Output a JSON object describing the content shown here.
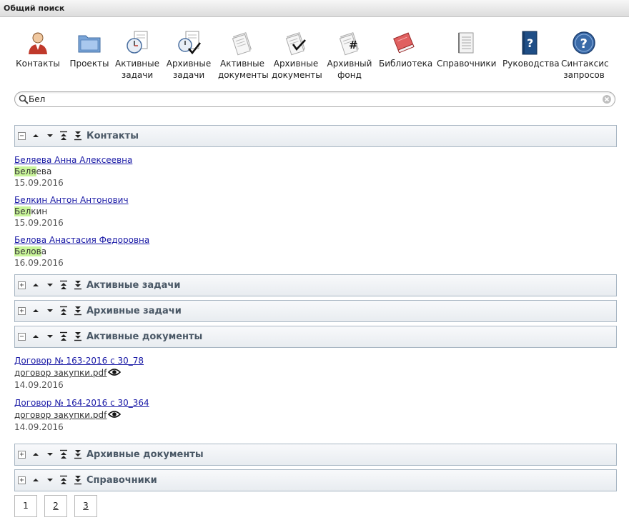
{
  "window": {
    "title": "Общий поиск"
  },
  "toolbar": {
    "items": [
      {
        "id": "contacts",
        "label_lines": [
          "Контакты"
        ]
      },
      {
        "id": "projects",
        "label_lines": [
          "Проекты"
        ]
      },
      {
        "id": "active-tasks",
        "label_lines": [
          "Активные",
          "задачи"
        ]
      },
      {
        "id": "archive-tasks",
        "label_lines": [
          "Архивные",
          "задачи"
        ]
      },
      {
        "id": "active-docs",
        "label_lines": [
          "Активные",
          "документы"
        ]
      },
      {
        "id": "archive-docs",
        "label_lines": [
          "Архивные",
          "документы"
        ]
      },
      {
        "id": "archive-fund",
        "label_lines": [
          "Архивный",
          "фонд"
        ]
      },
      {
        "id": "library",
        "label_lines": [
          "Библиотека"
        ]
      },
      {
        "id": "references",
        "label_lines": [
          "Справочники"
        ]
      },
      {
        "id": "manuals",
        "label_lines": [
          "Руководства"
        ]
      },
      {
        "id": "query-syntax",
        "label_lines": [
          "Синтаксис",
          "запросов"
        ]
      }
    ]
  },
  "search": {
    "value": "Бел",
    "icon": "search-icon",
    "clear_icon": "clear-icon"
  },
  "sections": {
    "contacts": {
      "title": "Контакты",
      "toggle": "−"
    },
    "active_tasks": {
      "title": "Активные задачи",
      "toggle": "+"
    },
    "archive_tasks": {
      "title": "Архивные задачи",
      "toggle": "+"
    },
    "active_docs": {
      "title": "Активные документы",
      "toggle": "−"
    },
    "archive_docs": {
      "title": "Архивные документы",
      "toggle": "+"
    },
    "references": {
      "title": "Справочники",
      "toggle": "+"
    }
  },
  "contacts": [
    {
      "name": "Беляева Анна Алексеевна",
      "match": "Беля",
      "rest": "ева",
      "date": "15.09.2016"
    },
    {
      "name": "Белкин Антон Антонович",
      "match": "Бел",
      "rest": "кин",
      "date": "15.09.2016"
    },
    {
      "name": "Белова Анастасия Федоровна",
      "match": "Белов",
      "rest": "а",
      "date": "16.09.2016"
    }
  ],
  "documents": [
    {
      "title": "Договор № 163-2016 с 30_78",
      "file": "договор закупки.pdf",
      "date": "14.09.2016"
    },
    {
      "title": "Договор № 164-2016 с 30_364",
      "file": "договор закупки.pdf",
      "date": "14.09.2016"
    }
  ],
  "pager": {
    "pages": [
      "1",
      "2",
      "3"
    ],
    "current": "1"
  },
  "colors": {
    "highlight": "#c9f59a",
    "link": "#1a1aa6",
    "section_border": "#a8b6c3",
    "section_title": "#4a5866"
  }
}
